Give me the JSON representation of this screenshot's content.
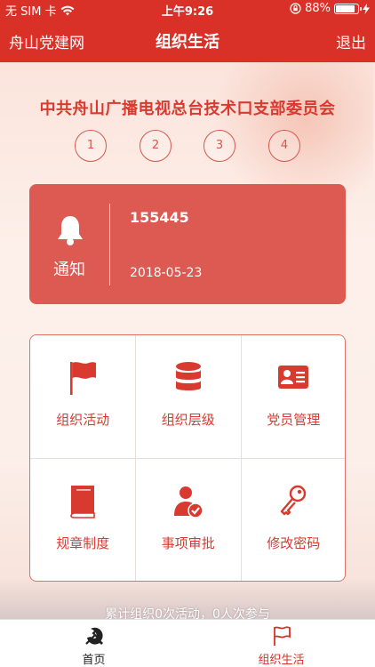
{
  "status_bar": {
    "carrier": "无 SIM 卡",
    "time": "上午9:26",
    "battery_percent": "88%",
    "battery_level": 0.88
  },
  "nav": {
    "left": "舟山党建网",
    "title": "组织生活",
    "right": "退出"
  },
  "org_name": "中共舟山广播电视总台技术口支部委员会",
  "steps": [
    "1",
    "2",
    "3",
    "4"
  ],
  "notice": {
    "label": "通知",
    "title": "155445",
    "date": "2018-05-23"
  },
  "menu": [
    {
      "label": "组织活动",
      "icon": "flag-icon"
    },
    {
      "label": "组织层级",
      "icon": "database-stack-icon"
    },
    {
      "label": "党员管理",
      "icon": "id-card-icon"
    },
    {
      "label": "规章制度",
      "icon": "book-icon"
    },
    {
      "label": "事项审批",
      "icon": "user-check-icon"
    },
    {
      "label": "修改密码",
      "icon": "key-icon"
    }
  ],
  "summary": "累计组织0次活动，0人次参与",
  "tabs": [
    {
      "label": "首页",
      "icon": "party-emblem-icon",
      "active": false
    },
    {
      "label": "组织生活",
      "icon": "flag-outline-icon",
      "active": true
    }
  ],
  "colors": {
    "primary_red": "#d93028",
    "card_red": "#dd5a52",
    "text_red": "#d93a30",
    "inactive_tab": "#222222"
  }
}
